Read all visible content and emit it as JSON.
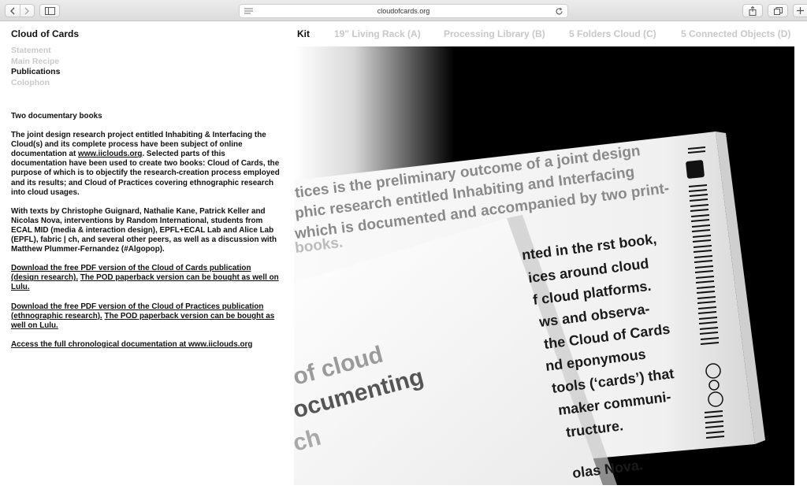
{
  "browser": {
    "url": "cloudofcards.org"
  },
  "site": {
    "title": "Cloud of Cards"
  },
  "topnav": {
    "items": [
      {
        "label": "Kit",
        "active": true
      },
      {
        "label": "19\" Living Rack (A)",
        "active": false
      },
      {
        "label": "Processing Library (B)",
        "active": false
      },
      {
        "label": "5 Folders Cloud (C)",
        "active": false
      },
      {
        "label": "5 Connected Objects (D)",
        "active": false
      }
    ]
  },
  "leftnav": {
    "items": [
      {
        "label": "Statement",
        "active": false
      },
      {
        "label": "Main Recipe",
        "active": false
      },
      {
        "label": "Publications",
        "active": true
      },
      {
        "label": "Colophon",
        "active": false
      }
    ]
  },
  "content": {
    "heading": "Two documentary books",
    "p1_before": "The joint design research project entitled Inhabiting & Interfacing the Cloud(s) and its complete process have been subject of online documentation at ",
    "p1_link": "www.iiclouds.org",
    "p1_after": ". Selected parts of this documentation have been used to create two books: Cloud of Cards, the purpose of which is to objectify the research-creation process employed and its results; and Cloud of Practices covering ethnographic research into cloud usages.",
    "p2": "With texts by Christophe Guignard, Nathalie Kane, Patrick Keller and Nicolas Nova, interventions by Random International, students from ECAL MID (media & interaction design), EPFL+ECAL Lab and Alice Lab (EPFL), fabric | ch, and several other peers, as well as a discussion with Matthew Plummer-Fernandez (#Algopop).",
    "p3_link1": "Download the free PDF version of the Cloud of Cards publication (design research).",
    "p3_link2": "The POD paperback version can be bought as well on Lulu.",
    "p4_link1": "Download the free PDF version of the Cloud of Practices publication (ethnographic research).",
    "p4_link2": "The POD paperback version can be bought as well on Lulu.",
    "p5_link": "Access the full chronological documentation at www.iiclouds.org"
  },
  "photo": {
    "back_page_lines": [
      "tices is the preliminary outcome of a joint design",
      "phic research entitled Inhabiting and Interfacing",
      "which is documented and accompanied by two print-",
      "books."
    ],
    "right_page_lines": [
      "nted in the  rst book,",
      "ices around cloud",
      "f cloud platforms.",
      "ws and observa-",
      "the Cloud of Cards",
      "nd eponymous",
      "tools (‘cards’) that",
      "maker communi-",
      "tructure.",
      "olas Nova."
    ],
    "front_page_lines": [
      "of cloud",
      "ocumenting",
      "ch"
    ]
  }
}
